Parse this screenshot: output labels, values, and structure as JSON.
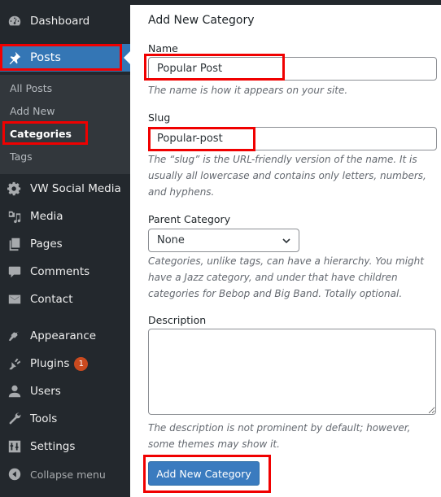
{
  "sidebar": {
    "items": [
      {
        "label": "Dashboard",
        "icon": "dashboard-icon"
      },
      {
        "label": "Posts",
        "icon": "pin-icon",
        "active": true
      },
      {
        "label": "VW Social Media",
        "icon": "gear-icon"
      },
      {
        "label": "Media",
        "icon": "media-icon"
      },
      {
        "label": "Pages",
        "icon": "pages-icon"
      },
      {
        "label": "Comments",
        "icon": "comment-icon"
      },
      {
        "label": "Contact",
        "icon": "envelope-icon"
      },
      {
        "label": "Appearance",
        "icon": "paintbrush-icon"
      },
      {
        "label": "Plugins",
        "icon": "plug-icon",
        "badge": "1"
      },
      {
        "label": "Users",
        "icon": "user-icon"
      },
      {
        "label": "Tools",
        "icon": "wrench-icon"
      },
      {
        "label": "Settings",
        "icon": "sliders-icon"
      }
    ],
    "submenu": [
      {
        "label": "All Posts"
      },
      {
        "label": "Add New"
      },
      {
        "label": "Categories",
        "current": true
      },
      {
        "label": "Tags"
      }
    ],
    "collapse_label": "Collapse menu"
  },
  "form": {
    "heading": "Add New Category",
    "name": {
      "label": "Name",
      "value": "Popular Post",
      "help": "The name is how it appears on your site."
    },
    "slug": {
      "label": "Slug",
      "value": "Popular-post",
      "help": "The “slug” is the URL-friendly version of the name. It is usually all lowercase and contains only letters, numbers, and hyphens."
    },
    "parent": {
      "label": "Parent Category",
      "selected": "None",
      "help": "Categories, unlike tags, can have a hierarchy. You might have a Jazz category, and under that have children categories for Bebop and Big Band. Totally optional."
    },
    "description": {
      "label": "Description",
      "value": "",
      "help": "The description is not prominent by default; however, some themes may show it."
    },
    "submit_label": "Add New Category"
  },
  "colors": {
    "sidebar_bg": "#23282d",
    "active_bg": "#3476b5",
    "highlight": "#f00000",
    "button": "#3a7bbf",
    "badge": "#ca4a1f"
  }
}
